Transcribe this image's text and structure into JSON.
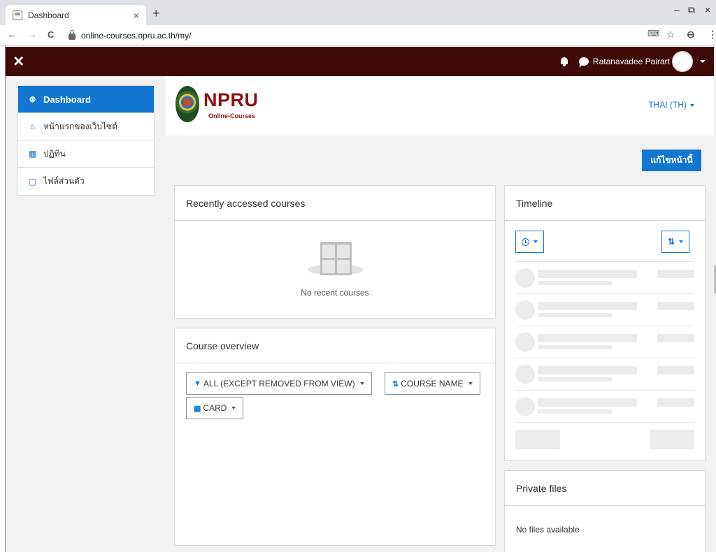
{
  "browser": {
    "tab_title": "Dashboard",
    "tab_close": "×",
    "new_tab": "+",
    "url": "online-courses.npru.ac.th/my/",
    "win_min": "–",
    "win_restore": "⧉",
    "win_close": "×",
    "back": "←",
    "forward": "→",
    "reload": "C",
    "translate": "⌨",
    "star": "☆",
    "profile": "⊖",
    "menu": "⋮"
  },
  "navbar": {
    "close_symbol": "×",
    "username": "Ratanavadee Pairart"
  },
  "drawer": {
    "items": [
      {
        "label": "Dashboard",
        "icon": "dashboard-icon",
        "glyph": "⊛",
        "active": true
      },
      {
        "label": "หน้าแรกของเว็บไซต์",
        "icon": "home-icon",
        "glyph": "⌂",
        "active": false
      },
      {
        "label": "ปฏิทิน",
        "icon": "calendar-icon",
        "glyph": "▦",
        "active": false
      },
      {
        "label": "ไฟล์ส่วนตัว",
        "icon": "file-icon",
        "glyph": "▢",
        "active": false
      }
    ]
  },
  "header": {
    "logo_text": "NPRU",
    "logo_sub": "Online-Courses",
    "language": "THAI (TH)"
  },
  "edit_button": "แก้ไขหน้านี้",
  "recent": {
    "title": "Recently accessed courses",
    "empty_message": "No recent courses"
  },
  "overview": {
    "title": "Course overview",
    "filter_label": "ALL (EXCEPT REMOVED FROM VIEW)",
    "sort_label": "COURSE NAME",
    "view_label": "CARD"
  },
  "timeline": {
    "title": "Timeline"
  },
  "private_files": {
    "title": "Private files",
    "empty_message": "No files available"
  },
  "colors": {
    "brand_dark": "#3e0a05",
    "accent": "#1177d1",
    "logo_red": "#8e1010"
  }
}
